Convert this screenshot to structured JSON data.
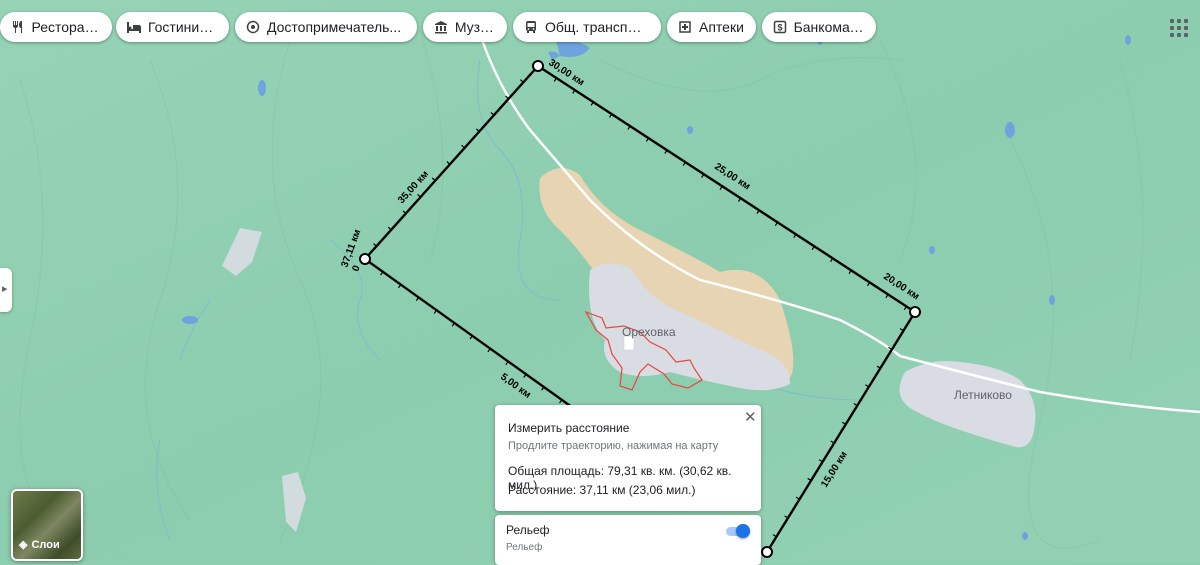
{
  "chips": [
    {
      "label": "Рестораны",
      "icon": "fork-knife-icon"
    },
    {
      "label": "Гостиницы",
      "icon": "bed-icon"
    },
    {
      "label": "Достопримечатель...",
      "icon": "landmark-icon"
    },
    {
      "label": "Музеи",
      "icon": "museum-icon"
    },
    {
      "label": "Общ. транспорт",
      "icon": "bus-icon"
    },
    {
      "label": "Аптеки",
      "icon": "pharmacy-icon"
    },
    {
      "label": "Банкоматы",
      "icon": "atm-icon"
    }
  ],
  "map": {
    "places": {
      "village1": "Ореховка",
      "village2": "Летниково"
    },
    "distance_labels": {
      "d30": "30,00 км",
      "d25": "25,00 км",
      "d20": "20,00 км",
      "d15": "15,00 км",
      "d5": "5,00 км",
      "d35": "35,00 км",
      "total": "37,11 км",
      "zero": "0"
    }
  },
  "measure_panel": {
    "title": "Измерить расстояние",
    "hint": "Продлите траекторию, нажимая на карту",
    "area": "Общая площадь: 79,31 кв. км. (30,62 кв. мил.)",
    "distance": "Расстояние: 37,11 км (23,06 мил.)",
    "close_icon": "close-icon"
  },
  "relief_panel": {
    "title": "Рельеф",
    "subtitle": "Рельеф",
    "toggle_on": true
  },
  "layers_button": {
    "label": "Слои",
    "icon": "layers-icon"
  },
  "colors": {
    "map_green": "#8fcfb1",
    "water": "#6fa3df",
    "sand": "#e7d4b2",
    "urban": "#d9dde3",
    "measure_line": "#000000",
    "boundary_red": "#e8453c",
    "accent": "#1a73e8"
  }
}
